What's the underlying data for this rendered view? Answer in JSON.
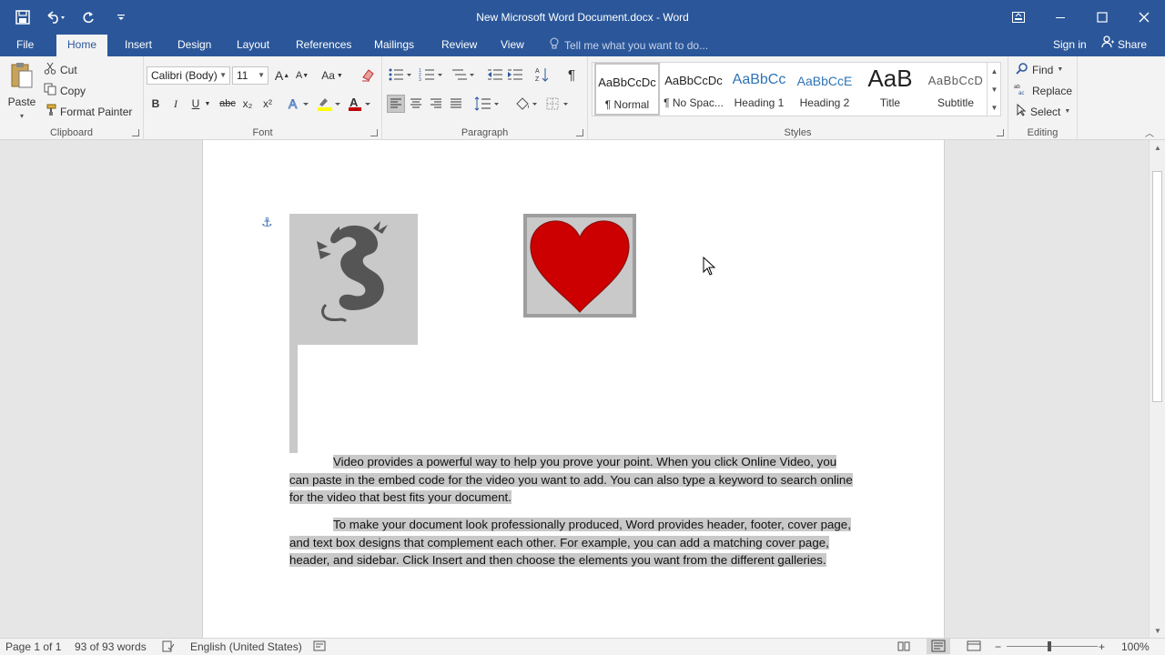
{
  "window": {
    "title": "New Microsoft Word Document.docx - Word"
  },
  "qat": {
    "save_icon": "save-icon",
    "undo_icon": "undo-icon",
    "redo_icon": "repeat-icon",
    "customize_icon": "customize-icon"
  },
  "tabs": [
    {
      "label": "File"
    },
    {
      "label": "Home"
    },
    {
      "label": "Insert"
    },
    {
      "label": "Design"
    },
    {
      "label": "Layout"
    },
    {
      "label": "References"
    },
    {
      "label": "Mailings"
    },
    {
      "label": "Review"
    },
    {
      "label": "View"
    }
  ],
  "tellme": {
    "placeholder": "Tell me what you want to do..."
  },
  "account": {
    "signin": "Sign in",
    "share": "Share"
  },
  "clipboard": {
    "paste": "Paste",
    "cut": "Cut",
    "copy": "Copy",
    "format_painter": "Format Painter",
    "label": "Clipboard"
  },
  "font": {
    "family": "Calibri (Body)",
    "size": "11",
    "label": "Font",
    "bold": "B",
    "italic": "I",
    "underline": "U",
    "strike": "abc",
    "subscript": "x₂",
    "superscript": "x²",
    "grow": "A",
    "shrink": "A",
    "case": "Aa",
    "color_accent": "#c00000",
    "highlight_accent": "#ffff00"
  },
  "paragraph": {
    "label": "Paragraph",
    "pilcrow": "¶"
  },
  "styles": {
    "label": "Styles",
    "items": [
      {
        "preview": "AaBbCcDc",
        "name": "¶ Normal"
      },
      {
        "preview": "AaBbCcDc",
        "name": "¶ No Spac..."
      },
      {
        "preview": "AaBbCc",
        "name": "Heading 1"
      },
      {
        "preview": "AaBbCcE",
        "name": "Heading 2"
      },
      {
        "preview": "AaB",
        "name": "Title"
      },
      {
        "preview": "AaBbCcD",
        "name": "Subtitle"
      }
    ]
  },
  "editing": {
    "label": "Editing",
    "find": "Find",
    "replace": "Replace",
    "select": "Select"
  },
  "document": {
    "paragraphs": [
      "Video provides a powerful way to help you prove your point. When you click Online Video, you can paste in the embed code for the video you want to add. You can also type a keyword to search online for the video that best fits your document.",
      "To make your document look professionally produced, Word provides header, footer, cover page, and text box designs that complement each other. For example, you can add a matching cover page, header, and sidebar. Click Insert and then choose the elements you want from the different galleries."
    ],
    "heart_color": "#cc0000",
    "dragon_color": "#555555"
  },
  "status": {
    "page": "Page 1 of 1",
    "words": "93 of 93 words",
    "language": "English (United States)",
    "zoom": "100%"
  },
  "colors": {
    "brand": "#2b579a",
    "selection": "#c9c9c9"
  }
}
